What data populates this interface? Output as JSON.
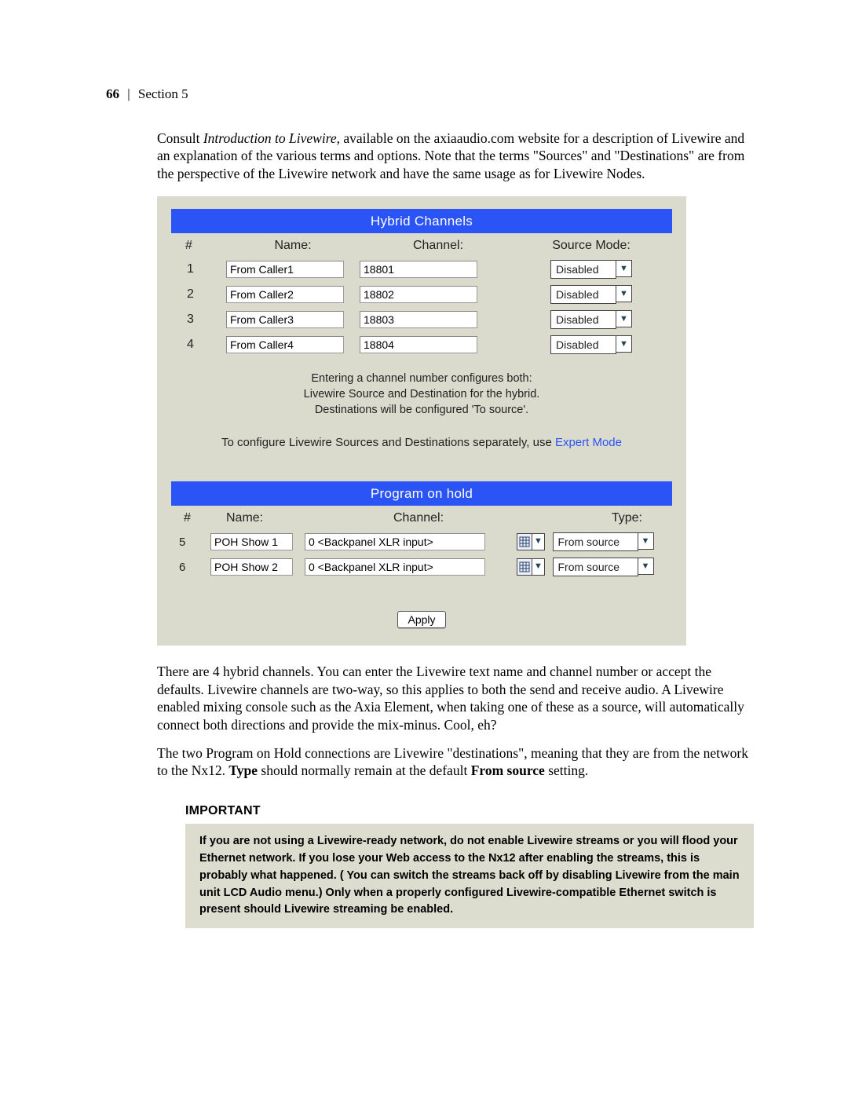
{
  "header": {
    "page_number": "66",
    "separator": "|",
    "section": "Section 5"
  },
  "intro": {
    "pre": "Consult ",
    "ital": "Introduction to Livewire",
    "post": ", available on the axiaaudio.com website for a description of Livewire and an explanation of the various terms and options. Note that the terms \"Sources\" and \"Destinations\" are from the perspective of the Livewire network and have the same usage as for Livewire Nodes."
  },
  "panel": {
    "title1": "Hybrid Channels",
    "headers": {
      "num": "#",
      "name": "Name:",
      "channel": "Channel:",
      "mode": "Source Mode:"
    },
    "rows": [
      {
        "num": "1",
        "name": "From Caller1",
        "channel": "18801",
        "mode": "Disabled"
      },
      {
        "num": "2",
        "name": "From Caller2",
        "channel": "18802",
        "mode": "Disabled"
      },
      {
        "num": "3",
        "name": "From Caller3",
        "channel": "18803",
        "mode": "Disabled"
      },
      {
        "num": "4",
        "name": "From Caller4",
        "channel": "18804",
        "mode": "Disabled"
      }
    ],
    "hint1": "Entering a channel number configures both:",
    "hint2": "Livewire Source and Destination for the hybrid.",
    "hint3": "Destinations will be configured 'To source'.",
    "expert_pre": "To configure Livewire Sources and Destinations separately, use ",
    "expert_link": "Expert Mode",
    "title2": "Program on hold",
    "headers2": {
      "num": "#",
      "name": "Name:",
      "channel": "Channel:",
      "type": "Type:"
    },
    "rows2": [
      {
        "num": "5",
        "name": "POH Show 1",
        "channel": "0 <Backpanel XLR input>",
        "type": "From source"
      },
      {
        "num": "6",
        "name": "POH Show 2",
        "channel": "0 <Backpanel XLR input>",
        "type": "From source"
      }
    ],
    "apply": "Apply"
  },
  "para2": "There are 4 hybrid channels. You can enter the Livewire text name and channel number or accept the defaults. Livewire channels are two-way, so this applies to both the send and receive audio. A Livewire enabled mixing console such as the Axia Element, when taking one of these as a source, will automatically connect both directions and provide the mix-minus. Cool, eh?",
  "para3": {
    "pre": "The two Program on Hold connections are Livewire \"destinations\", meaning that they are from the network to the Nx12. ",
    "b1": "Type",
    "mid": " should normally remain at the default ",
    "b2": "From source",
    "post": " setting."
  },
  "important": {
    "head": "IMPORTANT",
    "body": "If you are not using a Livewire-ready network, do not enable Livewire streams or you will flood your Ethernet network. If you lose your Web access to the Nx12 after enabling the streams, this is probably what happened. ( You can switch the streams back off by disabling Livewire from the main unit LCD Audio menu.) Only when a properly configured Livewire-compatible Ethernet switch is present should Livewire streaming be enabled."
  }
}
